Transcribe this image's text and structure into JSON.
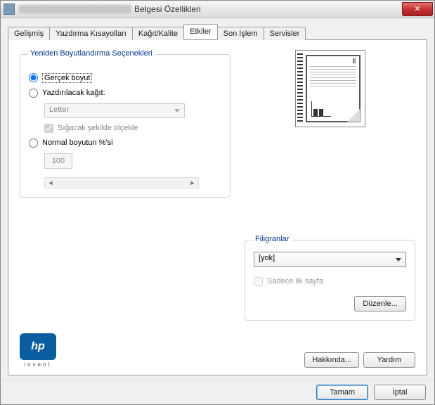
{
  "window": {
    "title_suffix": "Belgesi Özellikleri",
    "close": "✕"
  },
  "tabs": {
    "t0": "Gelişmiş",
    "t1": "Yazdırma Kısayolları",
    "t2": "Kağıt/Kalite",
    "t3": "Etkiler",
    "t4": "Son İşlem",
    "t5": "Servisler"
  },
  "resize": {
    "group_title": "Yeniden Boyutlandırma Seçenekleri",
    "actual": "Gerçek boyut",
    "print_on": "Yazdırılacak kağıt:",
    "paper_value": "Letter",
    "scale_fit": "Sığacak şekilde ölçekle",
    "percent": "Normal boyutun %'si",
    "percent_value": "100"
  },
  "watermark": {
    "group_title": "Filigranlar",
    "value": "[yok]",
    "first_page": "Sadece ilk sayfa",
    "edit": "Düzenle..."
  },
  "logo": {
    "mark": "hp",
    "invent": "invent"
  },
  "bottom_buttons": {
    "about": "Hakkında...",
    "help": "Yardım"
  },
  "footer": {
    "ok": "Tamam",
    "cancel": "İptal"
  }
}
